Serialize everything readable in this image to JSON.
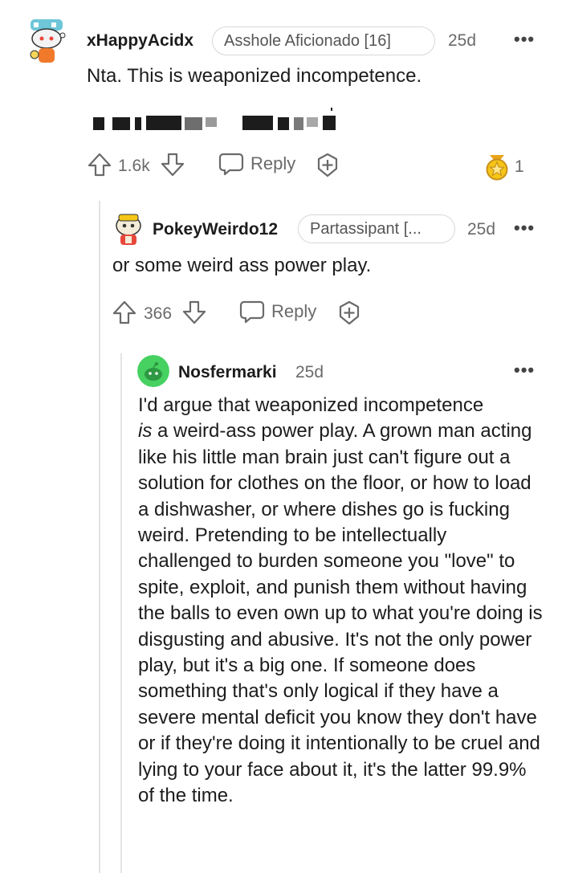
{
  "comments": [
    {
      "username": "xHappyAcidx",
      "flair": "Asshole Aficionado [16]",
      "age": "25d",
      "more": "•••",
      "text": "Nta. This is weaponized incompetence.",
      "score": "1.6k",
      "reply_label": "Reply",
      "award_count": "1"
    },
    {
      "username": "PokeyWeirdo12",
      "flair": "Partassipant [...",
      "age": "25d",
      "more": "•••",
      "text": "or some weird ass power play.",
      "score": "366",
      "reply_label": "Reply"
    },
    {
      "username": "Nosfermarki",
      "age": "25d",
      "more": "•••",
      "text_before_italic": "I'd argue that weaponized incompetence",
      "italic_word": "is",
      "text_after_italic": " a weird-ass power play. A grown man acting like his little man brain just can't figure out a solution for clothes on the floor, or how to load a dishwasher, or where dishes go is fucking weird. Pretending to be intellectually challenged to burden someone you \"love\" to spite, exploit, and punish them without having the balls to even own up to what you're doing is disgusting and abusive. It's not the only power play, but it's a big one. If someone does something that's only logical if they have a severe mental deficit you know they don't have or if they're doing it intentionally to be cruel and lying to your face about it, it's the latter 99.9% of the time."
    }
  ],
  "icons": {
    "upvote": "upvote-arrow-icon",
    "downvote": "downvote-arrow-icon",
    "reply": "speech-bubble-icon",
    "award": "plus-award-icon",
    "received_award": "gold-award-icon"
  },
  "colors": {
    "text": "#1c1c1c",
    "meta": "#6a6a6a",
    "thread_line": "#e3e3e3",
    "award_gold": "#f5c518",
    "avatar_green": "#46d160"
  }
}
